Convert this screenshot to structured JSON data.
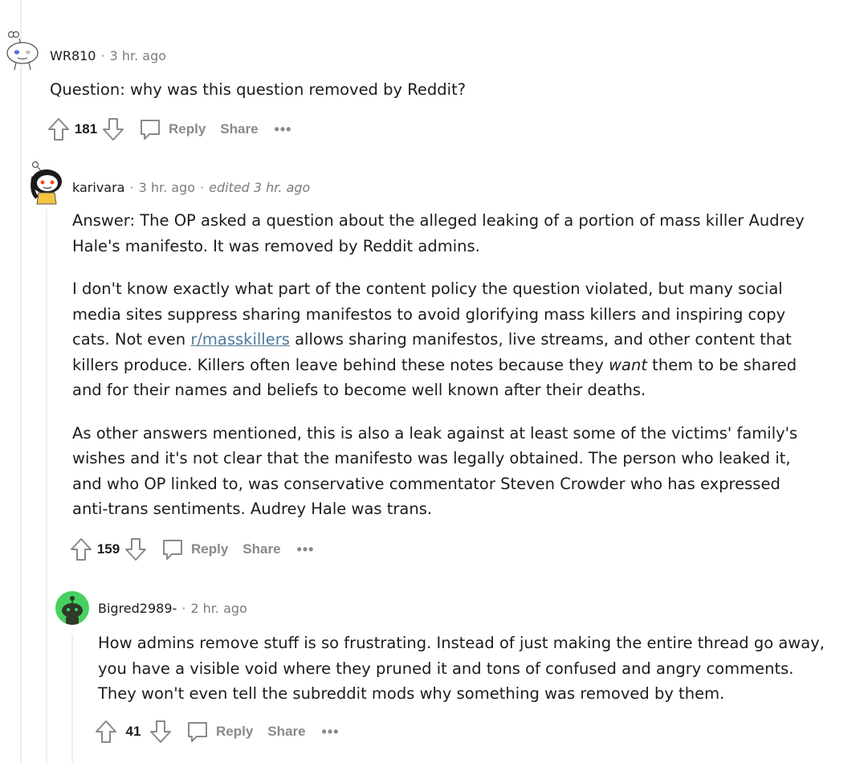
{
  "comments": [
    {
      "author": "WR810",
      "time": "3 hr. ago",
      "paragraphs": [
        "Question: why was this question removed by Reddit?"
      ],
      "score": "181",
      "reply_label": "Reply",
      "share_label": "Share"
    },
    {
      "author": "karivara",
      "time": "3 hr. ago",
      "edited": "edited 3 hr. ago",
      "p1": "Answer: The OP asked a question about the alleged leaking of a portion of mass killer Audrey Hale's manifesto. It was removed by Reddit admins.",
      "p2_a": "I don't know exactly what part of the content policy the question violated, but many social media sites suppress sharing manifestos to avoid glorifying mass killers and inspiring copy cats. Not even ",
      "p2_link": "r/masskillers",
      "p2_b": " allows sharing manifestos, live streams, and other content that killers produce. Killers often leave behind these notes because they ",
      "p2_em": "want",
      "p2_c": " them to be shared and for their names and beliefs to become well known after their deaths.",
      "p3": "As other answers mentioned, this is also a leak against at least some of the victims' family's wishes and it's not clear that the manifesto was legally obtained. The person who leaked it, and who OP linked to, was conservative commentator Steven Crowder who has expressed anti-trans sentiments. Audrey Hale was trans.",
      "score": "159",
      "reply_label": "Reply",
      "share_label": "Share"
    },
    {
      "author": "Bigred2989-",
      "time": "2 hr. ago",
      "p1": "How admins remove stuff is so frustrating. Instead of just making the entire thread go away, you have a visible void where they pruned it and tons of confused and angry comments. They won't even tell the subreddit mods why something was removed by them.",
      "score": "41",
      "reply_label": "Reply",
      "share_label": "Share"
    }
  ],
  "separator": "·",
  "icons": {
    "upvote": "upvote-arrow-icon",
    "downvote": "downvote-arrow-icon",
    "comment": "comment-bubble-icon",
    "more": "more-options-icon"
  },
  "colors": {
    "link": "#4f7a9a",
    "muted": "#878a8c",
    "thread": "#edeff1",
    "avatar_green": "#46d160"
  }
}
